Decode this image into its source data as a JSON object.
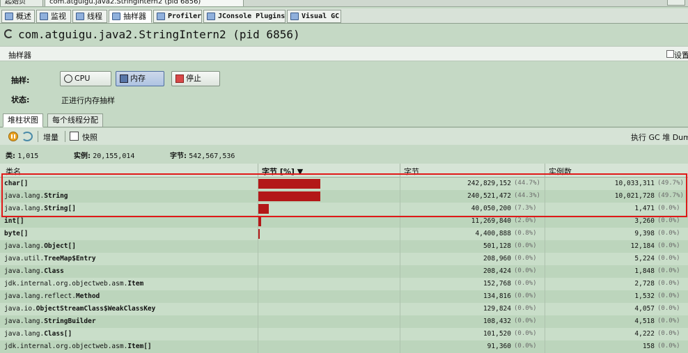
{
  "doc_tabs": {
    "start_page": "起始页",
    "process_tab": "com.atguigu.java2.StringIntern2 (pid 6856)"
  },
  "tool_tabs": [
    {
      "label": "概述",
      "icon": "overview-icon"
    },
    {
      "label": "监视",
      "icon": "monitor-icon"
    },
    {
      "label": "线程",
      "icon": "threads-icon"
    },
    {
      "label": "抽样器",
      "icon": "sampler-icon"
    },
    {
      "label": "Profiler",
      "icon": "profiler-icon"
    },
    {
      "label": "JConsole Plugins",
      "icon": "jconsole-icon"
    },
    {
      "label": "Visual GC",
      "icon": "visualgc-icon"
    }
  ],
  "header": {
    "title": "com.atguigu.java2.StringIntern2",
    "pid": "(pid 6856)"
  },
  "section": {
    "title": "抽样器",
    "settings_label": "设置"
  },
  "sampler": {
    "label": "抽样:",
    "cpu_button": "CPU",
    "memory_button": "内存",
    "stop_button": "停止",
    "status_label": "状态:",
    "status_value": "正进行内存抽样"
  },
  "view_tabs": [
    "堆柱状图",
    "每个线程分配"
  ],
  "toolbar": {
    "delta": "增量",
    "snapshot": "快照",
    "perform_gc": "执行 GC",
    "heap_dump": "堆 Dump"
  },
  "summary": {
    "classes_label": "类:",
    "classes_value": "1,015",
    "instances_label": "实例:",
    "instances_value": "20,155,014",
    "bytes_label": "字节:",
    "bytes_value": "542,567,536"
  },
  "table": {
    "columns": [
      "类名",
      "字节 [%] ▼",
      "字节",
      "实例数"
    ],
    "rows": [
      {
        "pkg": "",
        "cls": "char[]",
        "bytes": "242,829,152",
        "bytes_pct": "(44.7%)",
        "bar_pct": 44.7,
        "inst": "10,033,311",
        "inst_pct": "(49.7%)"
      },
      {
        "pkg": "java.lang.",
        "cls": "String",
        "bytes": "240,521,472",
        "bytes_pct": "(44.3%)",
        "bar_pct": 44.3,
        "inst": "10,021,728",
        "inst_pct": "(49.7%)"
      },
      {
        "pkg": "java.lang.",
        "cls": "String[]",
        "bytes": "40,050,200",
        "bytes_pct": "(7.3%)",
        "bar_pct": 7.3,
        "inst": "1,471",
        "inst_pct": "(0.0%)"
      },
      {
        "pkg": "",
        "cls": "int[]",
        "bytes": "11,269,840",
        "bytes_pct": "(2.0%)",
        "bar_pct": 2.0,
        "inst": "3,260",
        "inst_pct": "(0.0%)"
      },
      {
        "pkg": "",
        "cls": "byte[]",
        "bytes": "4,400,888",
        "bytes_pct": "(0.8%)",
        "bar_pct": 0.8,
        "inst": "9,398",
        "inst_pct": "(0.0%)"
      },
      {
        "pkg": "java.lang.",
        "cls": "Object[]",
        "bytes": "501,128",
        "bytes_pct": "(0.0%)",
        "bar_pct": 0,
        "inst": "12,184",
        "inst_pct": "(0.0%)"
      },
      {
        "pkg": "java.util.",
        "cls": "TreeMap$Entry",
        "bytes": "208,960",
        "bytes_pct": "(0.0%)",
        "bar_pct": 0,
        "inst": "5,224",
        "inst_pct": "(0.0%)"
      },
      {
        "pkg": "java.lang.",
        "cls": "Class",
        "bytes": "208,424",
        "bytes_pct": "(0.0%)",
        "bar_pct": 0,
        "inst": "1,848",
        "inst_pct": "(0.0%)"
      },
      {
        "pkg": "jdk.internal.org.objectweb.asm.",
        "cls": "Item",
        "bytes": "152,768",
        "bytes_pct": "(0.0%)",
        "bar_pct": 0,
        "inst": "2,728",
        "inst_pct": "(0.0%)"
      },
      {
        "pkg": "java.lang.reflect.",
        "cls": "Method",
        "bytes": "134,816",
        "bytes_pct": "(0.0%)",
        "bar_pct": 0,
        "inst": "1,532",
        "inst_pct": "(0.0%)"
      },
      {
        "pkg": "java.io.",
        "cls": "ObjectStreamClass$WeakClassKey",
        "bytes": "129,824",
        "bytes_pct": "(0.0%)",
        "bar_pct": 0,
        "inst": "4,057",
        "inst_pct": "(0.0%)"
      },
      {
        "pkg": "java.lang.",
        "cls": "StringBuilder",
        "bytes": "108,432",
        "bytes_pct": "(0.0%)",
        "bar_pct": 0,
        "inst": "4,518",
        "inst_pct": "(0.0%)"
      },
      {
        "pkg": "java.lang.",
        "cls": "Class[]",
        "bytes": "101,520",
        "bytes_pct": "(0.0%)",
        "bar_pct": 0,
        "inst": "4,222",
        "inst_pct": "(0.0%)"
      },
      {
        "pkg": "jdk.internal.org.objectweb.asm.",
        "cls": "Item[]",
        "bytes": "91,360",
        "bytes_pct": "(0.0%)",
        "bar_pct": 0,
        "inst": "158",
        "inst_pct": "(0.0%)"
      }
    ]
  },
  "colors": {
    "bar": "#b31818",
    "highlight": "#e01818",
    "background": "#c5d9c5"
  }
}
